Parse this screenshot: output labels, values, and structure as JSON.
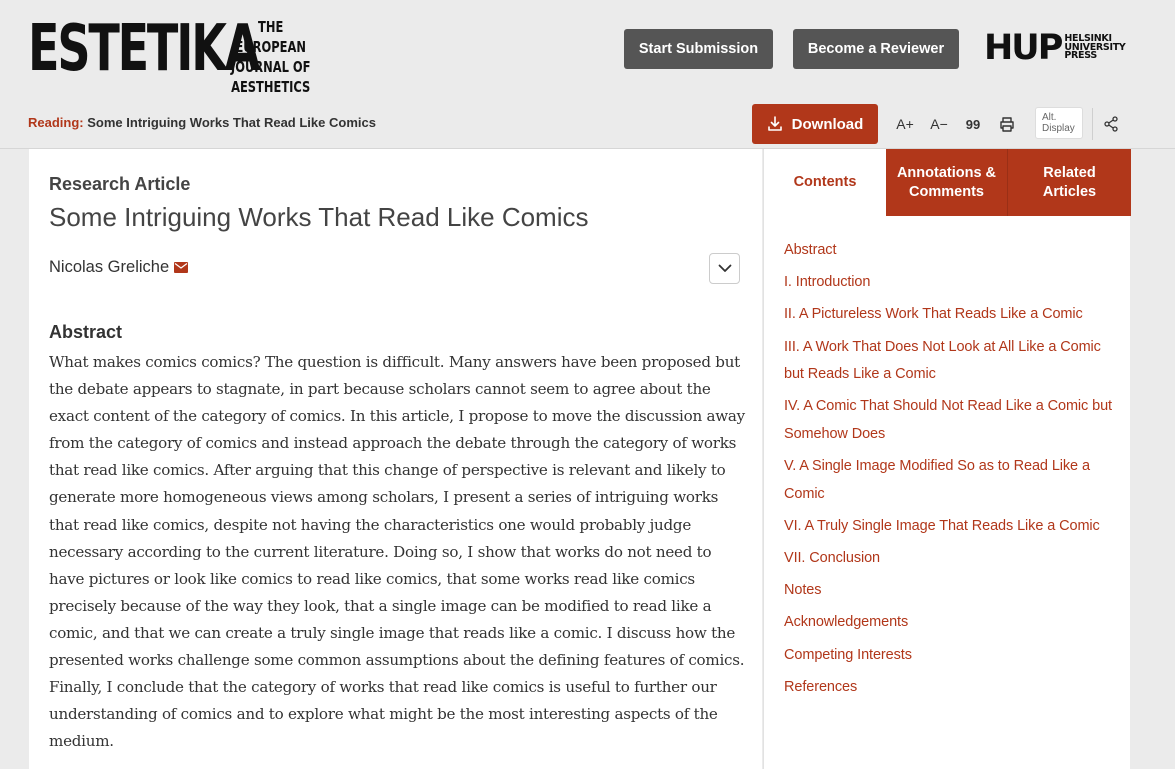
{
  "header": {
    "logo_main": "ESTETIKA",
    "logo_sub": [
      "THE EUROPEAN",
      "JOURNAL OF",
      "AESTHETICS"
    ],
    "start_submission": "Start Submission",
    "become_reviewer": "Become a Reviewer",
    "publisher_abbr": "HUP",
    "publisher_full": [
      "HELSINKI",
      "UNIVERSITY",
      "PRESS"
    ]
  },
  "toolbar": {
    "reading_label": "Reading:",
    "reading_title": "Some Intriguing Works That Read Like Comics",
    "download_label": "Download",
    "increase_font": "A+",
    "decrease_font": "A−",
    "cite": "99",
    "alt_display": [
      "Alt.",
      "Display"
    ]
  },
  "article": {
    "type": "Research Article",
    "title": "Some Intriguing Works That Read Like Comics",
    "author": "Nicolas Greliche",
    "abstract_heading": "Abstract",
    "abstract_text": "What makes comics comics? The question is difficult. Many answers have been proposed but the debate appears to stagnate, in part because scholars cannot seem to agree about the exact content of the category of comics. In this article, I propose to move the discussion away from the category of comics and instead approach the debate through the category of works that read like comics. After arguing that this change of perspective is relevant and likely to generate more homogeneous views among scholars, I present a series of intriguing works that read like comics, despite not having the characteristics one would probably judge necessary according to the current literature. Doing so, I show that works do not need to have pictures or look like comics to read like comics, that some works read like comics precisely because of the way they look, that a single image can be modified to read like a comic, and that we can create a truly single image that reads like a comic. I discuss how the presented works challenge some common assumptions about the defining features of comics. Finally, I conclude that the category of works that read like comics is useful to further our understanding of comics and to explore what might be the most interesting aspects of the medium."
  },
  "sidebar": {
    "tabs": [
      "Contents",
      "Annotations & Comments",
      "Related Articles"
    ],
    "toc": [
      "Abstract",
      "I. Introduction",
      "II. A Pictureless Work That Reads Like a Comic",
      "III. A Work That Does Not Look at All Like a Comic but Reads Like a Comic",
      "IV. A Comic That Should Not Read Like a Comic but Somehow Does",
      "V. A Single Image Modified So as to Read Like a Comic",
      "VI. A Truly Single Image That Reads Like a Comic",
      "VII. Conclusion",
      "Notes",
      "Acknowledgements",
      "Competing Interests",
      "References"
    ]
  },
  "colors": {
    "accent": "#b1371a",
    "button_dark": "#555555",
    "background": "#ebebeb"
  },
  "icons": [
    "download-icon",
    "quote-icon",
    "print-icon",
    "share-icon",
    "mail-icon",
    "chevron-down-icon"
  ]
}
